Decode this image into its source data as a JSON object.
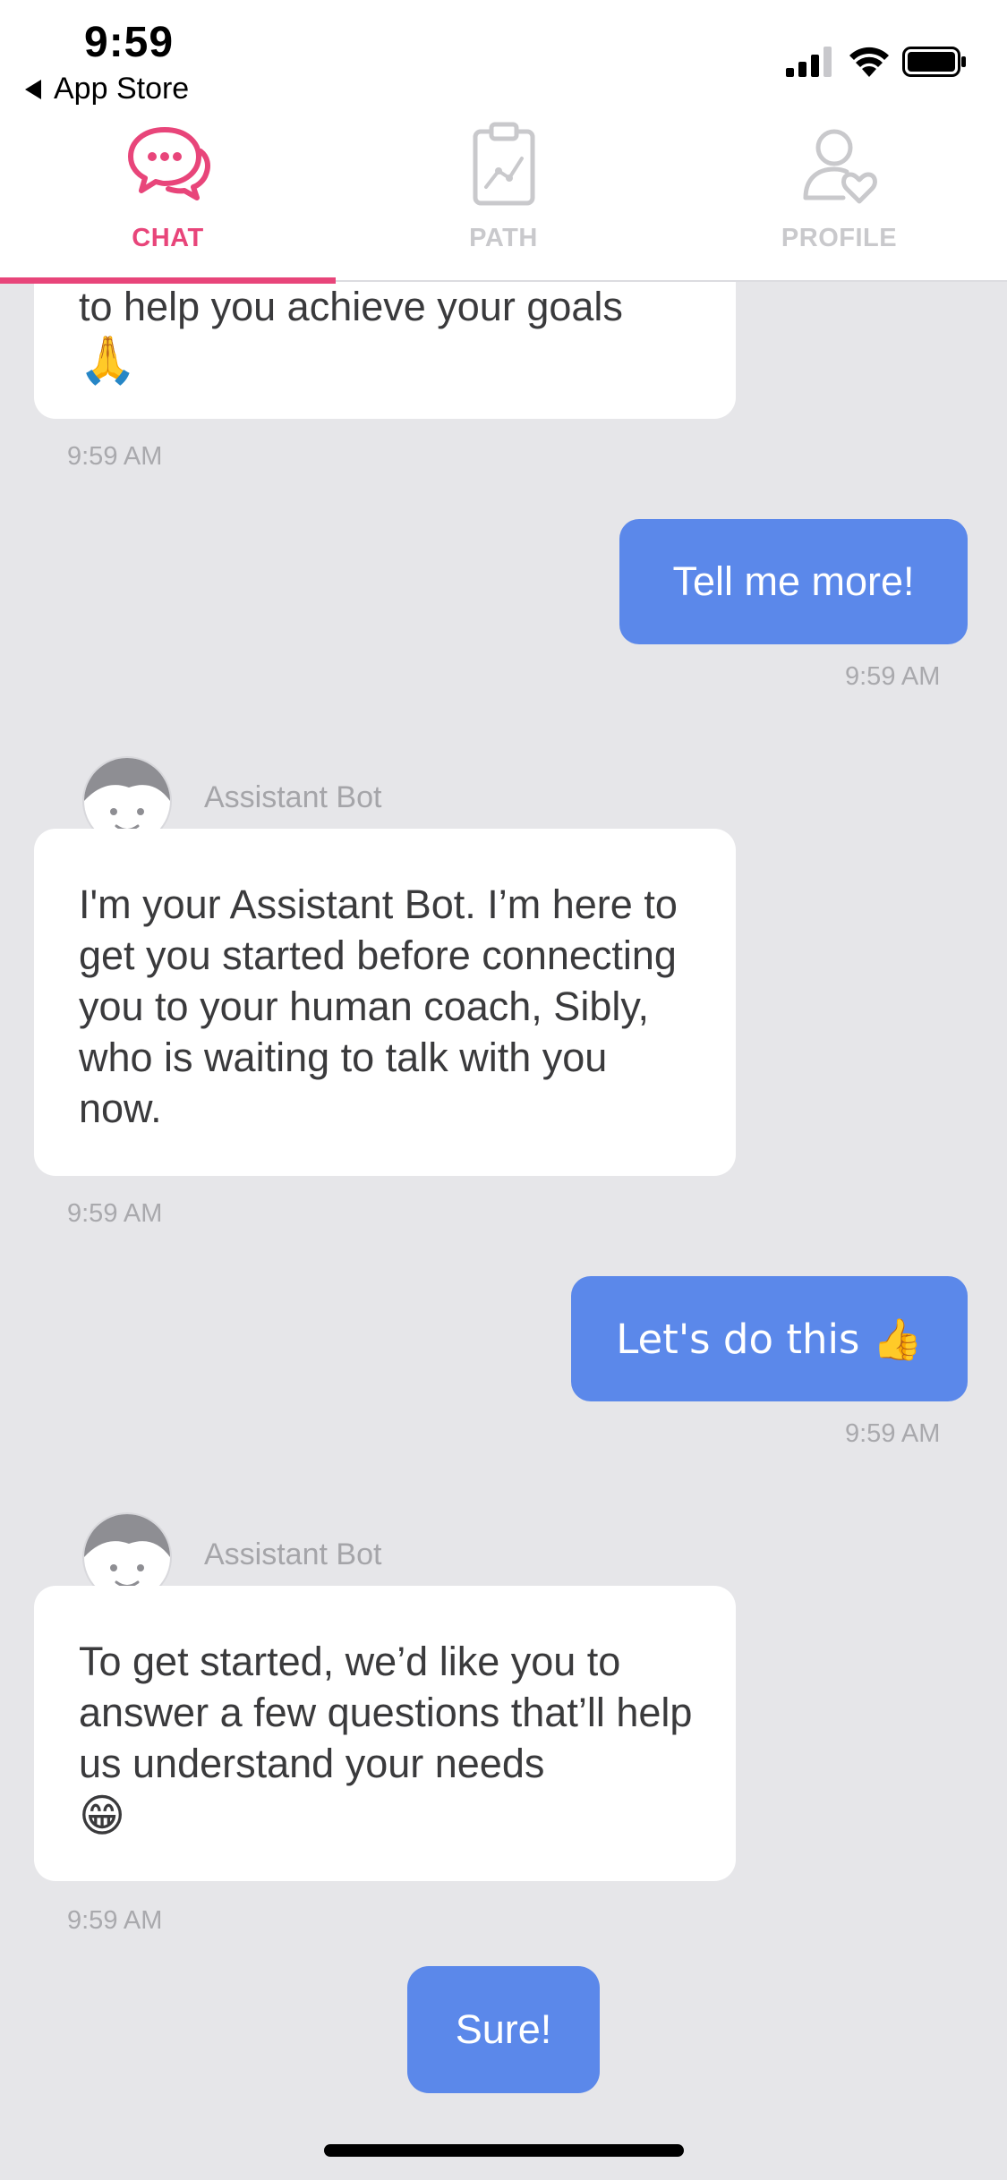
{
  "status_bar": {
    "time": "9:59",
    "back_label": "App Store",
    "icons": [
      "signal-icon",
      "wifi-icon",
      "battery-icon"
    ]
  },
  "tabs": [
    {
      "label": "CHAT",
      "icon": "chat-bubble-icon",
      "active": true
    },
    {
      "label": "PATH",
      "icon": "clipboard-chart-icon",
      "active": false
    },
    {
      "label": "PROFILE",
      "icon": "user-heart-icon",
      "active": false
    }
  ],
  "colors": {
    "accent": "#e8457a",
    "user_bubble": "#5b88ea",
    "background": "#e6e6e9",
    "inactive_tab": "#c9c9cc"
  },
  "messages": [
    {
      "type": "bot",
      "text_line1": "to help you achieve your goals",
      "emoji": "🙏",
      "time": "9:59 AM"
    },
    {
      "type": "user",
      "text": "Tell me more!",
      "time": "9:59 AM"
    },
    {
      "type": "bot",
      "sender": "Assistant Bot",
      "text": "I'm your Assistant Bot. I’m here to get you started before connecting you to your human coach, Sibly, who is waiting to talk with you now.",
      "time": "9:59 AM"
    },
    {
      "type": "user",
      "text": "Let's do this 👍",
      "time": "9:59 AM"
    },
    {
      "type": "bot",
      "sender": "Assistant Bot",
      "text": "To get started, we’d like you to answer a few questions that’ll help us understand your needs",
      "emoji": "😁",
      "time": "9:59 AM"
    }
  ],
  "quick_reply": {
    "label": "Sure!"
  }
}
